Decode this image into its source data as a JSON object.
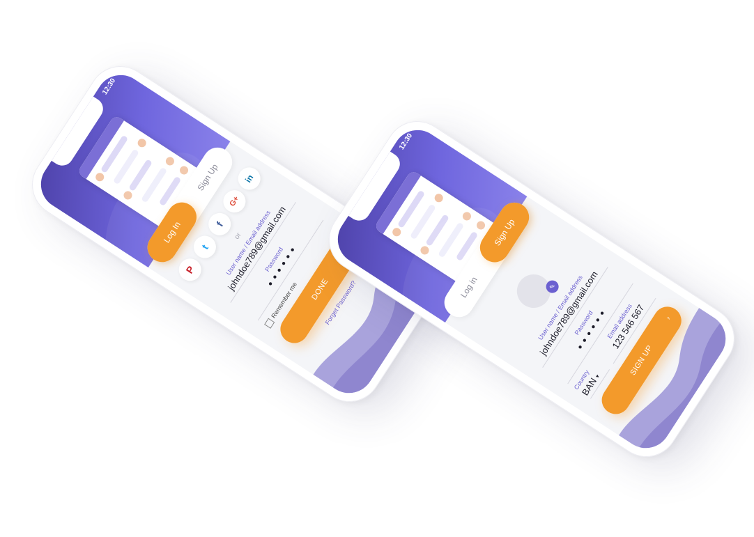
{
  "login_screen": {
    "status_time": "12:30",
    "tabs": {
      "login": "Log In",
      "signup": "Sign Up"
    },
    "social": {
      "pinterest": "P",
      "twitter": "t",
      "facebook": "f",
      "google": "G+",
      "linkedin": "in"
    },
    "or_text": "or",
    "username": {
      "label": "User name / Email address",
      "value": "johndoe789@gmail.com"
    },
    "password": {
      "label": "Password",
      "value": "••••••"
    },
    "remember_label": "Remember me",
    "done_label": "DONE",
    "forgot_label": "Forget Password?"
  },
  "signup_screen": {
    "status_time": "12:30",
    "tabs": {
      "login": "Log in",
      "signup": "Sign Up"
    },
    "username": {
      "label": "User name / Email address",
      "value": "johndoe789@gmail.com"
    },
    "password": {
      "label": "Password",
      "value": "••••••"
    },
    "country": {
      "label": "Country",
      "value": "BAN"
    },
    "email": {
      "label": "Email address",
      "value": "123 546 567"
    },
    "signup_label": "SIGN UP"
  },
  "colors": {
    "accent": "#f39a2b",
    "brand": "#6b60d0",
    "hero": "#5a4fc4",
    "wave": "#8f86cf"
  }
}
